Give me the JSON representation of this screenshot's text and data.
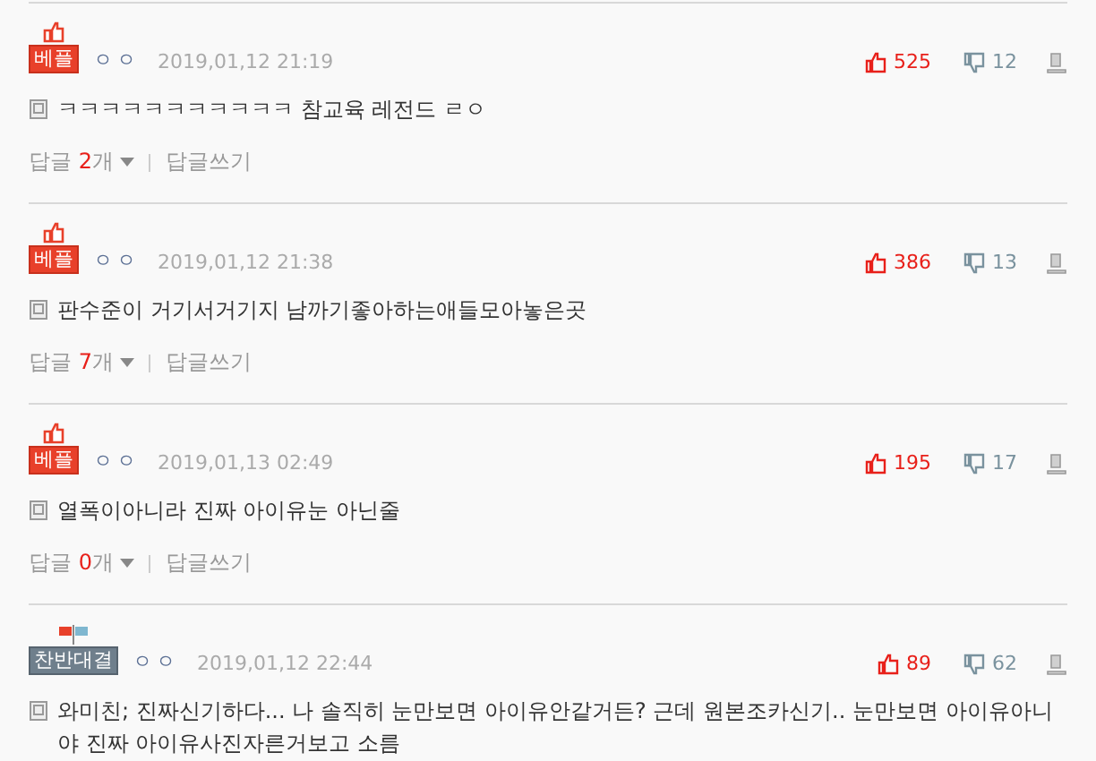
{
  "comments": [
    {
      "kind": "best",
      "badge": "베플",
      "user": "ㅇㅇ",
      "date": "2019,01,12 21:19",
      "likes": "525",
      "dislikes": "12",
      "text": "ㅋㅋㅋㅋㅋㅋㅋㅋㅋㅋㅋ 참교육 레전드 ㄹㅇ",
      "reply_label": "답글",
      "reply_count": "2",
      "reply_unit": "개",
      "write_label": "답글쓰기"
    },
    {
      "kind": "best",
      "badge": "베플",
      "user": "ㅇㅇ",
      "date": "2019,01,12 21:38",
      "likes": "386",
      "dislikes": "13",
      "text": "판수준이 거기서거기지 남까기좋아하는애들모아놓은곳",
      "reply_label": "답글",
      "reply_count": "7",
      "reply_unit": "개",
      "write_label": "답글쓰기"
    },
    {
      "kind": "best",
      "badge": "베플",
      "user": "ㅇㅇ",
      "date": "2019,01,13 02:49",
      "likes": "195",
      "dislikes": "17",
      "text": "열폭이아니라 진짜 아이유눈 아닌줄",
      "reply_label": "답글",
      "reply_count": "0",
      "reply_unit": "개",
      "write_label": "답글쓰기"
    },
    {
      "kind": "controversial",
      "badge": "찬반대결",
      "user": "ㅇㅇ",
      "date": "2019,01,12 22:44",
      "likes": "89",
      "dislikes": "62",
      "text": "와미친; 진짜신기하다... 나 솔직히 눈만보면 아이유안같거든? 근데 원본조카신기.. 눈만보면 아이유아니야 진짜 아이유사진자른거보고 소름"
    }
  ]
}
